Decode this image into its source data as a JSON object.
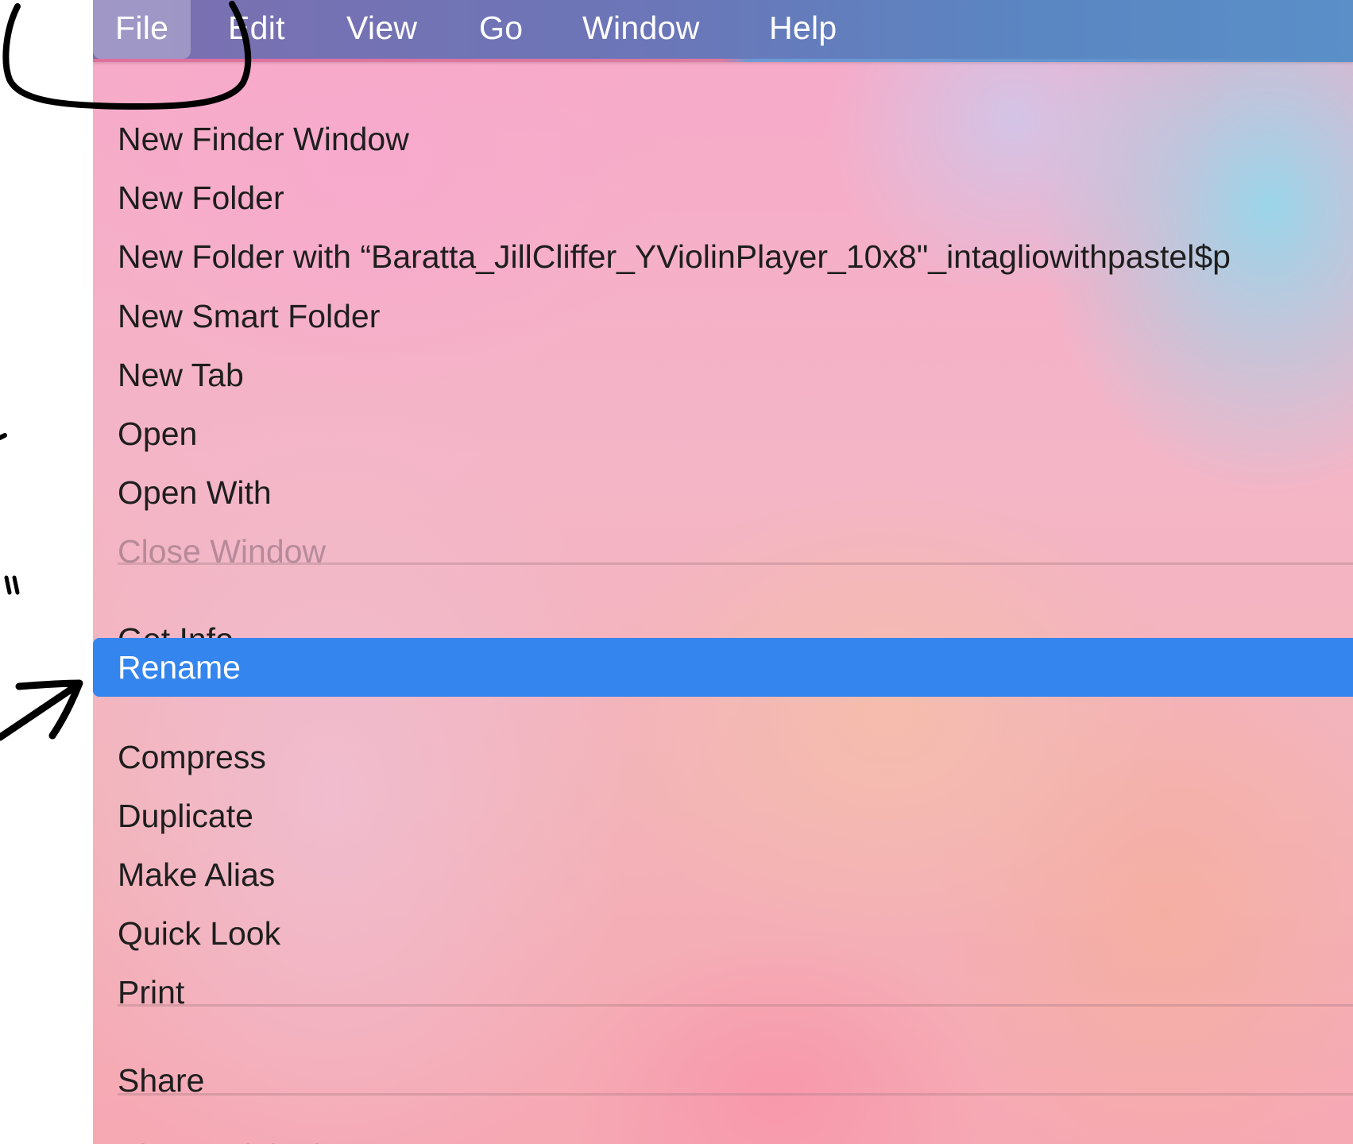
{
  "menubar": {
    "items": [
      "File",
      "Edit",
      "View",
      "Go",
      "Window",
      "Help"
    ],
    "active": "File"
  },
  "file_menu": {
    "items": [
      {
        "label": "New Finder Window",
        "enabled": true
      },
      {
        "label": "New Folder",
        "enabled": true
      },
      {
        "label": "New Folder with “Baratta_JillCliffer_YViolinPlayer_10x8\"_intagliowithpastel$p",
        "enabled": true
      },
      {
        "label": "New Smart Folder",
        "enabled": true
      },
      {
        "label": "New Tab",
        "enabled": true
      },
      {
        "label": "Open",
        "enabled": true
      },
      {
        "label": "Open With",
        "enabled": true
      },
      {
        "label": "Close Window",
        "enabled": false
      },
      {
        "separator": true
      },
      {
        "label": "Get Info",
        "enabled": true
      },
      {
        "label": "Rename",
        "enabled": true,
        "highlighted": true
      },
      {
        "label": "Compress",
        "enabled": true
      },
      {
        "label": "Duplicate",
        "enabled": true
      },
      {
        "label": "Make Alias",
        "enabled": true
      },
      {
        "label": "Quick Look",
        "enabled": true
      },
      {
        "label": "Print",
        "enabled": true
      },
      {
        "separator": true
      },
      {
        "label": "Share",
        "enabled": true
      },
      {
        "separator": true
      },
      {
        "label": "Show Original",
        "enabled": false
      }
    ]
  },
  "colors": {
    "highlight": "#3485ee",
    "menubar_start": "#7c6fb0",
    "menubar_end": "#5a8fc8",
    "annotation_ink": "#000000"
  },
  "annotations": {
    "circle_target": "File",
    "arrow_target": "Rename"
  }
}
